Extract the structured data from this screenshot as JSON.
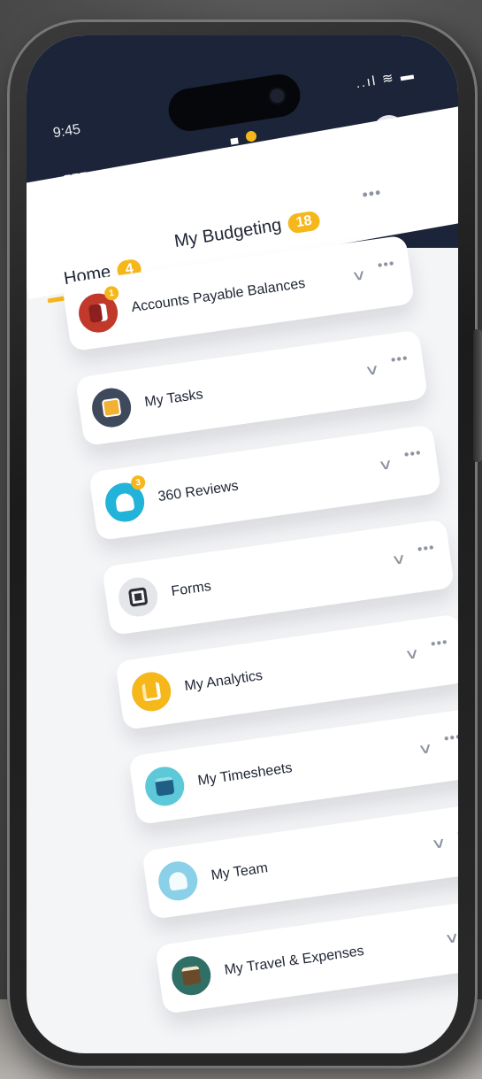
{
  "status_bar": {
    "time": "9:45",
    "indicators": "..ıl ≋ ▬"
  },
  "header": {
    "logo_text": "cia"
  },
  "tabs": [
    {
      "label": "Home",
      "count": "4",
      "active": true
    },
    {
      "label": "My Budgeting",
      "count": "18",
      "active": false
    }
  ],
  "tabs_more": "•••",
  "widgets": [
    {
      "title": "Accounts Payable Balances",
      "icon": "ledger-icon",
      "color": "#c0392b",
      "badge": "1"
    },
    {
      "title": "My Tasks",
      "icon": "checkbox-icon",
      "color": "#3e4a5c",
      "badge": ""
    },
    {
      "title": "360 Reviews",
      "icon": "people-group-icon",
      "color": "#22b3d9",
      "badge": "3"
    },
    {
      "title": "Forms",
      "icon": "form-document-icon",
      "color": "#e4e6ea",
      "badge": ""
    },
    {
      "title": "My Analytics",
      "icon": "bar-chart-icon",
      "color": "#f5b71a",
      "badge": ""
    },
    {
      "title": "My Timesheets",
      "icon": "calendar-icon",
      "color": "#5cc8d8",
      "badge": ""
    },
    {
      "title": "My Team",
      "icon": "team-icon",
      "color": "#8ad0e8",
      "badge": ""
    },
    {
      "title": "My Travel & Expenses",
      "icon": "wallet-icon",
      "color": "#2f6f66",
      "badge": ""
    }
  ],
  "widget_more": "•••",
  "widget_chevron": "∨",
  "colors": {
    "header": "#1b2438",
    "accent": "#f5b71a",
    "card": "#ffffff"
  }
}
